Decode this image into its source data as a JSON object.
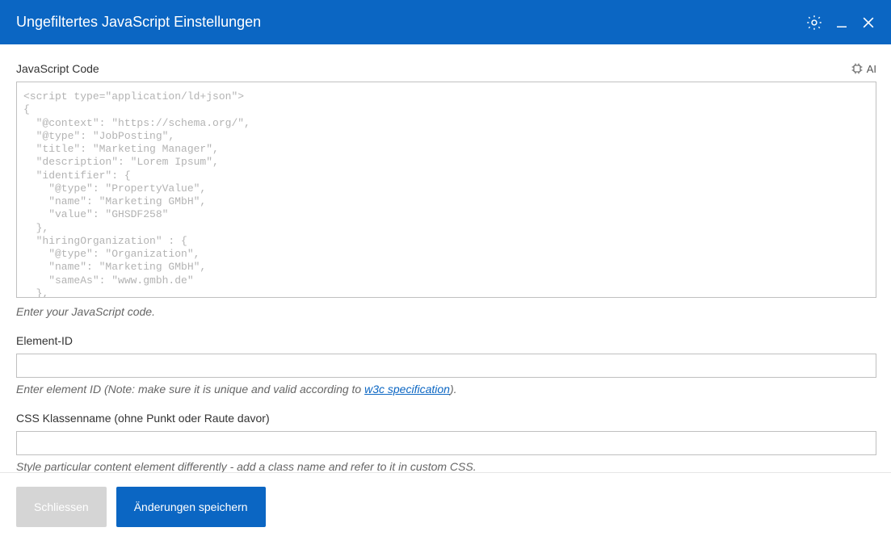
{
  "titlebar": {
    "title": "Ungefiltertes JavaScript Einstellungen"
  },
  "jsCode": {
    "label": "JavaScript Code",
    "aiLabel": "AI",
    "value": "<script type=\"application/ld+json\">\n{\n  \"@context\": \"https://schema.org/\",\n  \"@type\": \"JobPosting\",\n  \"title\": \"Marketing Manager\",\n  \"description\": \"Lorem Ipsum\",\n  \"identifier\": {\n    \"@type\": \"PropertyValue\",\n    \"name\": \"Marketing GMbH\",\n    \"value\": \"GHSDF258\"\n  },\n  \"hiringOrganization\" : {\n    \"@type\": \"Organization\",\n    \"name\": \"Marketing GMbH\",\n    \"sameAs\": \"www.gmbh.de\"\n  },\n  \"industry\": \"Maschinenbau\",",
    "hint": "Enter your JavaScript code."
  },
  "elementId": {
    "label": "Element-ID",
    "value": "",
    "hintPrefix": "Enter element ID (Note: make sure it is unique and valid according to ",
    "hintLinkText": "w3c specification",
    "hintSuffix": ")."
  },
  "cssClass": {
    "label": "CSS Klassenname (ohne Punkt oder Raute davor)",
    "value": "",
    "hint": "Style particular content element differently - add a class name and refer to it in custom CSS."
  },
  "footer": {
    "closeLabel": "Schliessen",
    "saveLabel": "Änderungen speichern"
  }
}
